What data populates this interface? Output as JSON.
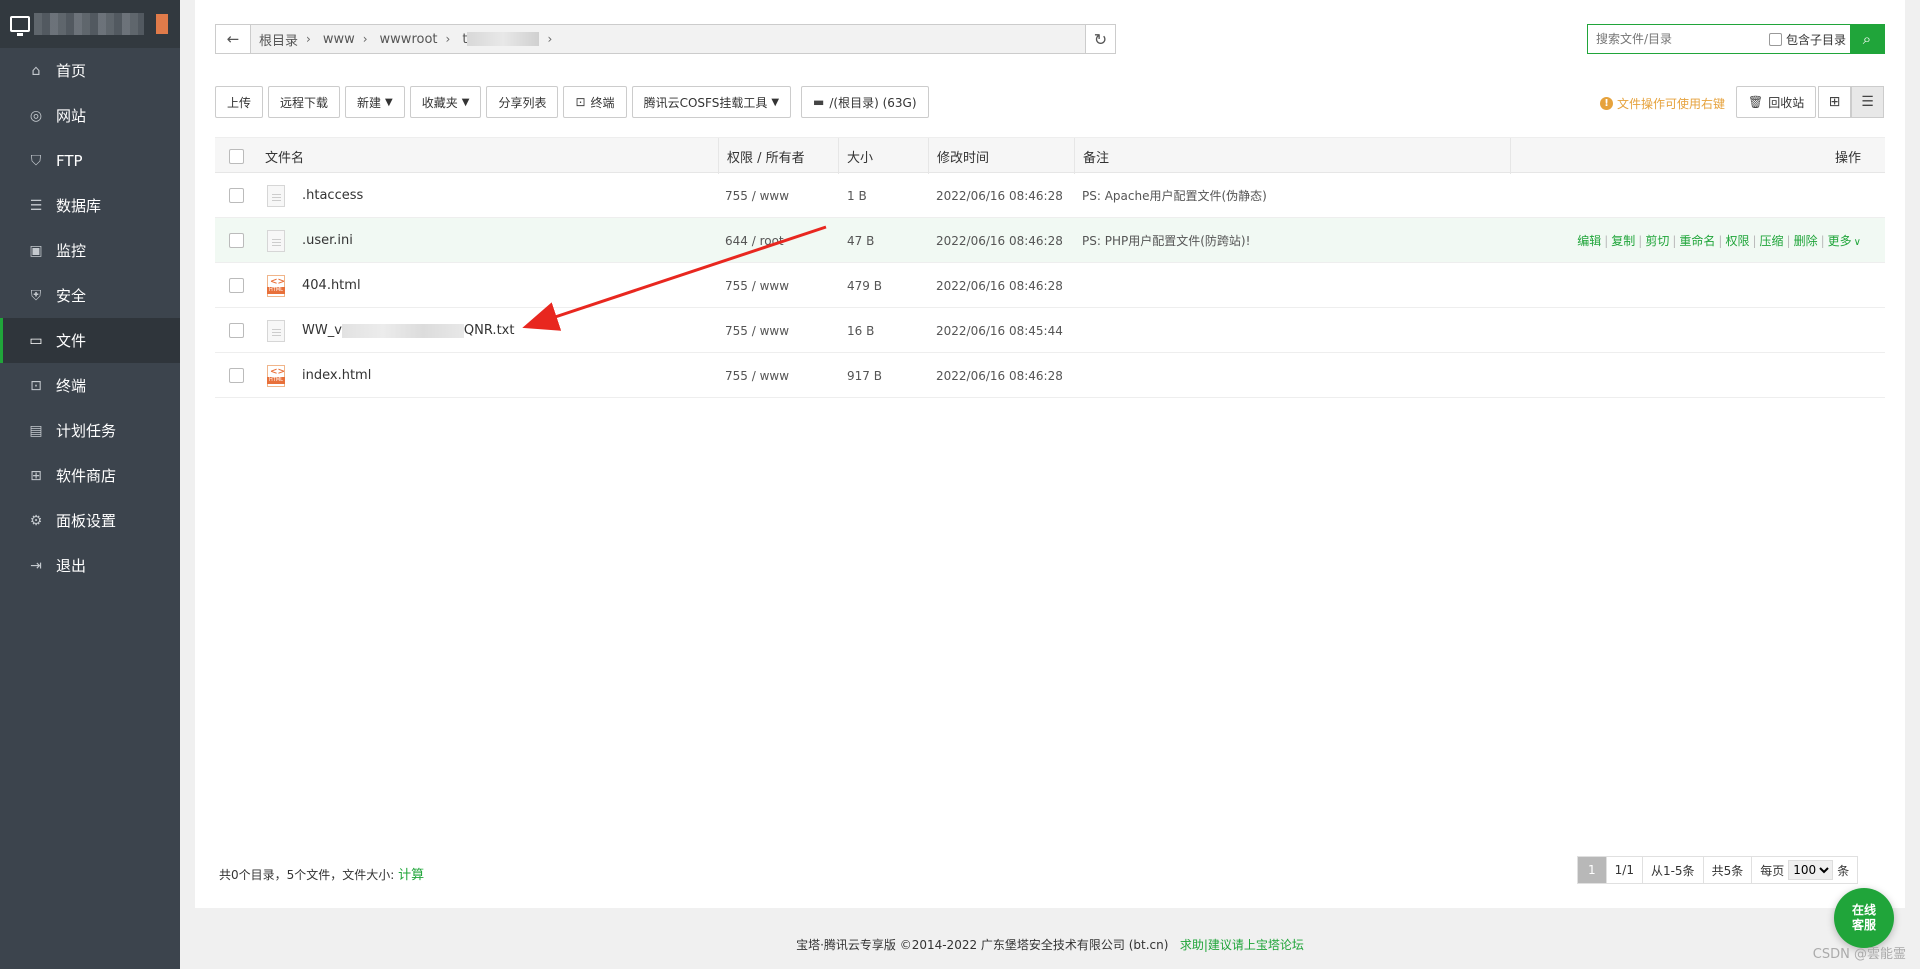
{
  "sidebar": {
    "items": [
      {
        "label": "首页",
        "icon": "home-icon"
      },
      {
        "label": "网站",
        "icon": "globe-icon"
      },
      {
        "label": "FTP",
        "icon": "ftp-icon"
      },
      {
        "label": "数据库",
        "icon": "database-icon"
      },
      {
        "label": "监控",
        "icon": "monitor-icon"
      },
      {
        "label": "安全",
        "icon": "shield-icon"
      },
      {
        "label": "文件",
        "icon": "folder-icon",
        "active": true
      },
      {
        "label": "终端",
        "icon": "terminal-icon"
      },
      {
        "label": "计划任务",
        "icon": "calendar-icon"
      },
      {
        "label": "软件商店",
        "icon": "apps-icon"
      },
      {
        "label": "面板设置",
        "icon": "gear-icon"
      },
      {
        "label": "退出",
        "icon": "logout-icon"
      }
    ]
  },
  "breadcrumb": {
    "items": [
      "根目录",
      "www",
      "wwwroot",
      "t"
    ]
  },
  "search": {
    "placeholder": "搜索文件/目录",
    "subdir_label": "包含子目录"
  },
  "toolbar": {
    "upload": "上传",
    "remote_download": "远程下载",
    "new": "新建",
    "favorites": "收藏夹",
    "share_list": "分享列表",
    "terminal": "终端",
    "cosfs": "腾讯云COSFS挂载工具",
    "disk": "/(根目录) (63G)",
    "tip": "文件操作可使用右键",
    "recycle": "回收站"
  },
  "table": {
    "headers": {
      "name": "文件名",
      "perm": "权限 / 所有者",
      "size": "大小",
      "mtime": "修改时间",
      "remark": "备注",
      "ops": "操作"
    },
    "rows": [
      {
        "name": ".htaccess",
        "icon": "text-file-icon",
        "perm": "755 / www",
        "size": "1 B",
        "mtime": "2022/06/16 08:46:28",
        "remark": "PS: Apache用户配置文件(伪静态)"
      },
      {
        "name": ".user.ini",
        "icon": "text-file-icon",
        "perm": "644 / root",
        "size": "47 B",
        "mtime": "2022/06/16 08:46:28",
        "remark": "PS: PHP用户配置文件(防跨站)!"
      },
      {
        "name": "404.html",
        "icon": "html-file-icon",
        "perm": "755 / www",
        "size": "479 B",
        "mtime": "2022/06/16 08:46:28",
        "remark": ""
      },
      {
        "name_prefix": "WW_v",
        "name_suffix": "QNR.txt",
        "icon": "text-file-icon",
        "perm": "755 / www",
        "size": "16 B",
        "mtime": "2022/06/16 08:45:44",
        "remark": ""
      },
      {
        "name": "index.html",
        "icon": "html-file-icon",
        "perm": "755 / www",
        "size": "917 B",
        "mtime": "2022/06/16 08:46:28",
        "remark": ""
      }
    ],
    "row_ops": [
      "编辑",
      "复制",
      "剪切",
      "重命名",
      "权限",
      "压缩",
      "删除",
      "更多"
    ]
  },
  "footer": {
    "summary": "共0个目录，5个文件，文件大小:",
    "calc": "计算",
    "pager": {
      "current": "1",
      "pages": "1/1",
      "range": "从1-5条",
      "total": "共5条",
      "per_page_label": "每页",
      "per_page": "100",
      "unit": "条"
    }
  },
  "copyright": {
    "text": "宝塔·腾讯云专享版 ©2014-2022 广东堡塔安全技术有限公司 (bt.cn)",
    "link": "求助|建议请上宝塔论坛"
  },
  "online_service": "在线客服",
  "watermark": "CSDN @雲能霊",
  "colors": {
    "accent": "#20a53a",
    "sidebar_bg": "#3c444d",
    "tip": "#e6a23c"
  }
}
